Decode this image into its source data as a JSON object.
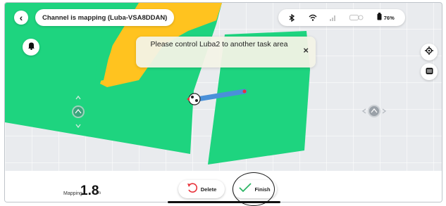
{
  "header": {
    "back_icon": "chevron-left-icon",
    "title": "Channel is mapping  (Luba-VSA8DDAN)"
  },
  "status": {
    "icons": [
      "bluetooth-icon",
      "wifi-icon",
      "cellular-signal-icon",
      "rtk-signal-icon",
      "battery-icon"
    ],
    "battery_percent": "76%"
  },
  "toast": {
    "message": "Please control Luba2 to another task area",
    "close_icon": "close-icon"
  },
  "side_controls": {
    "left": [
      "bell-icon"
    ],
    "right": [
      "locate-icon",
      "layers-icon"
    ]
  },
  "joysticks": {
    "left": "move-joystick-icon",
    "right": "rotate-joystick-icon"
  },
  "map": {
    "colors": {
      "area": "#1ed47f",
      "yellow_area": "#ffc31f",
      "path": "#4a90d9",
      "background": "#e9ebee"
    }
  },
  "bottom": {
    "mapping_label": "Mapping",
    "mapping_value": "1.8",
    "mapping_unit": "m",
    "delete_label": "Delete",
    "finish_label": "Finish"
  }
}
